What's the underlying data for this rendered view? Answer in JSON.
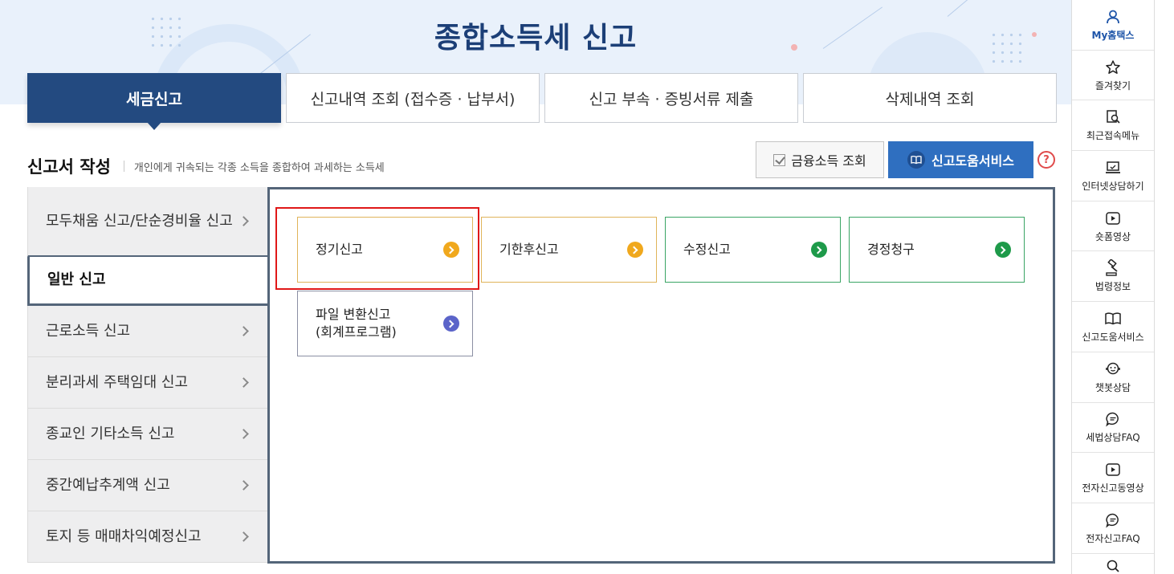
{
  "page": {
    "title": "종합소득세 신고"
  },
  "tabs": [
    {
      "label": "세금신고"
    },
    {
      "label": "신고내역 조회 (접수증 · 납부서)"
    },
    {
      "label": "신고 부속 · 증빙서류 제출"
    },
    {
      "label": "삭제내역 조회"
    }
  ],
  "section": {
    "title": "신고서 작성",
    "description": "개인에게 귀속되는 각종 소득을 종합하여 과세하는 소득세",
    "finance_button": "금융소득 조회",
    "help_button": "신고도움서비스",
    "help_icon": "?"
  },
  "leftmenu": [
    {
      "label": "모두채움 신고/단순경비율 신고"
    },
    {
      "label": "일반 신고"
    },
    {
      "label": "근로소득 신고"
    },
    {
      "label": "분리과세 주택임대 신고"
    },
    {
      "label": "종교인 기타소득 신고"
    },
    {
      "label": "중간예납추계액 신고"
    },
    {
      "label": "토지 등 매매차익예정신고"
    }
  ],
  "cards": [
    {
      "label": "정기신고",
      "color": "#f0a81d"
    },
    {
      "label": "기한후신고",
      "color": "#f0a81d"
    },
    {
      "label": "수정신고",
      "color": "#1e9a4a"
    },
    {
      "label": "경정청구",
      "color": "#1e9a4a"
    },
    {
      "label": "파일 변환신고\n(회계프로그램)",
      "color": "#5b64c9"
    }
  ],
  "quickbar": [
    {
      "label": "My홈택스",
      "icon": "person-icon"
    },
    {
      "label": "즐겨찾기",
      "icon": "star-icon"
    },
    {
      "label": "최근접속메뉴",
      "icon": "recent-icon"
    },
    {
      "label": "인터넷상담하기",
      "icon": "laptop-icon"
    },
    {
      "label": "숏폼영상",
      "icon": "play-icon"
    },
    {
      "label": "법령정보",
      "icon": "gavel-icon"
    },
    {
      "label": "신고도움서비스",
      "icon": "book-icon"
    },
    {
      "label": "챗봇상담",
      "icon": "chatbot-icon"
    },
    {
      "label": "세법상담FAQ",
      "icon": "chat-icon"
    },
    {
      "label": "전자신고동영상",
      "icon": "play-icon"
    },
    {
      "label": "전자신고FAQ",
      "icon": "chat-icon"
    }
  ]
}
